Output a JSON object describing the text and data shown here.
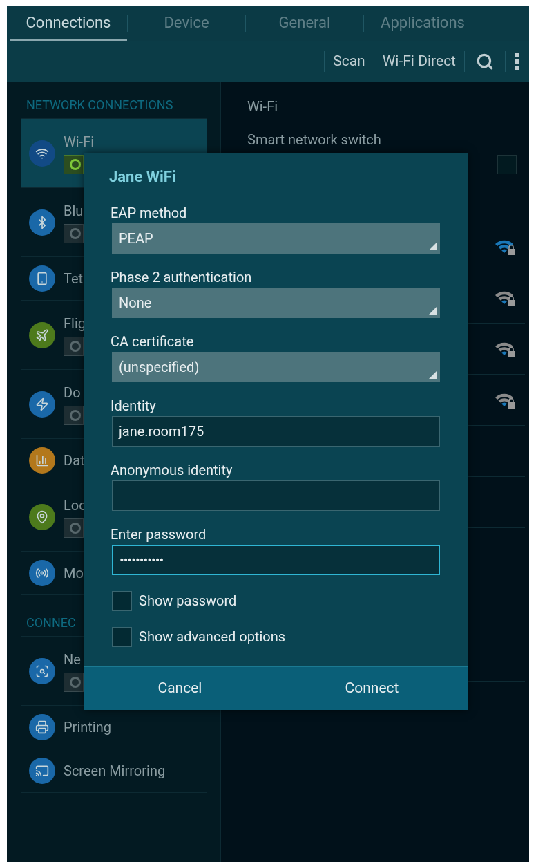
{
  "tabs": [
    {
      "label": "Connections",
      "selected": true
    },
    {
      "label": "Device",
      "selected": false
    },
    {
      "label": "General",
      "selected": false
    },
    {
      "label": "Applications",
      "selected": false
    }
  ],
  "actions": [
    "Scan",
    "Wi-Fi Direct"
  ],
  "sidebar": {
    "sections": [
      {
        "header": "NETWORK CONNECTIONS",
        "items": [
          {
            "label": "Wi-Fi",
            "kind": "switch",
            "on": true,
            "selected": true,
            "color": "#124a85"
          },
          {
            "label": "Blu",
            "kind": "switch",
            "on": false,
            "selected": false,
            "color": "#1a68a8"
          },
          {
            "label": "Tet",
            "kind": "plain",
            "selected": false,
            "color": "#1a68a8"
          },
          {
            "label": "Flig",
            "kind": "switch",
            "on": false,
            "selected": false,
            "color": "#4d7a1c"
          },
          {
            "label": "Do",
            "kind": "switch",
            "on": false,
            "selected": false,
            "color": "#1a68a8"
          },
          {
            "label": "Dat",
            "kind": "plain",
            "selected": false,
            "color": "#b3781c"
          },
          {
            "label": "Loc",
            "kind": "switch",
            "on": false,
            "selected": false,
            "color": "#4d7a1c"
          },
          {
            "label": "Mo",
            "kind": "plain",
            "selected": false,
            "color": "#1a68a8"
          }
        ]
      },
      {
        "header": "CONNEC",
        "items": [
          {
            "label": "Ne",
            "kind": "switch",
            "on": false,
            "selected": false,
            "color": "#1a68a8"
          },
          {
            "label": "Printing",
            "kind": "plain",
            "selected": false,
            "color": "#1a68a8"
          },
          {
            "label": "Screen Mirroring",
            "kind": "plain",
            "selected": false,
            "color": "#1a68a8"
          }
        ]
      }
    ]
  },
  "wifi_pane": {
    "title": "Wi-Fi",
    "smart_switch": {
      "label": "Smart network switch",
      "checked": false
    },
    "networks": [
      {
        "active": true
      },
      {
        "active": false
      },
      {
        "active": false
      },
      {
        "active": false
      }
    ]
  },
  "dialog": {
    "title": "Jane WiFi",
    "fields": [
      {
        "label": "EAP method",
        "kind": "dropdown",
        "value": "PEAP"
      },
      {
        "label": "Phase 2 authentication",
        "kind": "dropdown",
        "value": "None"
      },
      {
        "label": "CA certificate",
        "kind": "dropdown",
        "value": "(unspecified)"
      },
      {
        "label": "Identity",
        "kind": "text",
        "value": "jane.room175",
        "focused": false
      },
      {
        "label": "Anonymous identity",
        "kind": "text",
        "focused": false
      },
      {
        "label": "Enter password",
        "kind": "password",
        "value": "•••••••••••",
        "focused": true
      }
    ],
    "options": [
      {
        "label": "Show password",
        "checked": false
      },
      {
        "label": "Show advanced options",
        "checked": false
      }
    ],
    "buttons": [
      "Cancel",
      "Connect"
    ]
  }
}
